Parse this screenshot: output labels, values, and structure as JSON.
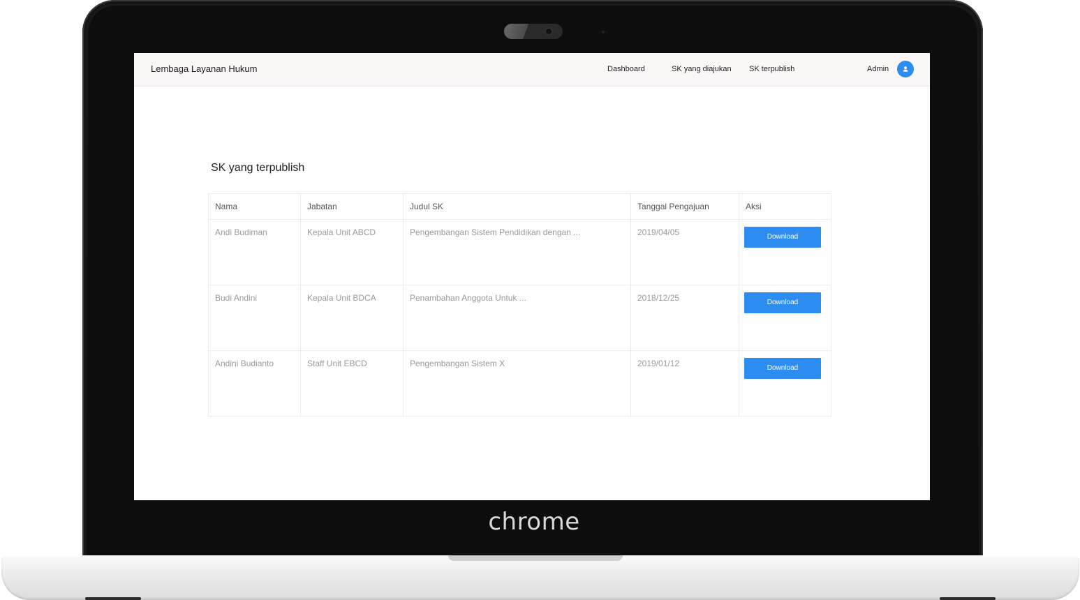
{
  "navbar": {
    "brand": "Lembaga Layanan Hukum",
    "links": [
      {
        "label": "Dashboard"
      },
      {
        "label": "SK yang diajukan"
      },
      {
        "label": "SK terpublish"
      }
    ],
    "user_label": "Admin",
    "avatar_icon": "user-icon"
  },
  "page": {
    "title": "SK yang terpublish"
  },
  "table": {
    "headers": [
      "Nama",
      "Jabatan",
      "Judul SK",
      "Tanggal Pengajuan",
      "Aksi"
    ],
    "rows": [
      {
        "nama": "Andi Budiman",
        "jabatan": "Kepala Unit ABCD",
        "judul": "Pengembangan Sistem Pendidikan dengan ...",
        "tanggal": "2019/04/05",
        "action": "Download"
      },
      {
        "nama": "Budi Andini",
        "jabatan": "Kepala Unit BDCA",
        "judul": "Penambahan Anggota Untuk ...",
        "tanggal": "2018/12/25",
        "action": "Download"
      },
      {
        "nama": "Andini Budianto",
        "jabatan": "Staff Unit EBCD",
        "judul": "Pengembangan Sistem X",
        "tanggal": "2019/01/12",
        "action": "Download"
      }
    ]
  },
  "device": {
    "logo_text": "chrome"
  },
  "colors": {
    "accent": "#2d8cf0",
    "navbar_bg": "#fcf7f7",
    "muted_text": "#9a9a9a"
  }
}
